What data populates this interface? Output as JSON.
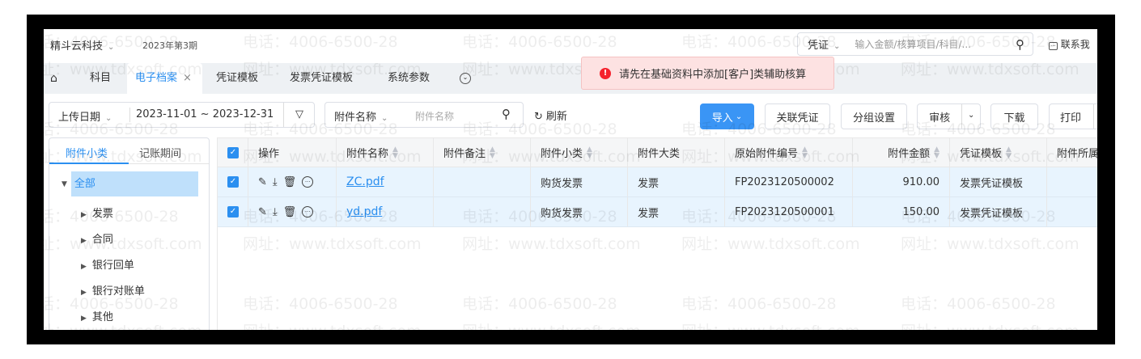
{
  "header": {
    "company": "精斗云科技",
    "period": "2023年第3期",
    "search_type": "凭证",
    "search_placeholder": "输入金额/核算项目/科目/...",
    "contact": "联系我"
  },
  "tabs": [
    {
      "label": "科目"
    },
    {
      "label": "电子档案",
      "active": true
    },
    {
      "label": "凭证模板"
    },
    {
      "label": "发票凭证模板"
    },
    {
      "label": "系统参数"
    }
  ],
  "toast": {
    "message": "请先在基础资料中添加[客户]类辅助核算",
    "color": "#f56c6c"
  },
  "toolbar": {
    "date_type": "上传日期",
    "date_range": "2023-11-01 ~ 2023-12-31",
    "name_field": "附件名称",
    "name_placeholder": "附件名称",
    "refresh": "刷新",
    "import": "导入",
    "link_voucher": "关联凭证",
    "group_settings": "分组设置",
    "review": "审核",
    "download": "下载",
    "print": "打印"
  },
  "sidebar": {
    "tabs": [
      "附件小类",
      "记账期间"
    ],
    "root": "全部",
    "items": [
      "发票",
      "合同",
      "银行回单",
      "银行对账单",
      "其他"
    ]
  },
  "table": {
    "columns": [
      "操作",
      "附件名称",
      "附件备注",
      "附件小类",
      "附件大类",
      "原始附件编号",
      "附件金额",
      "凭证模板",
      "附件所属"
    ],
    "rows": [
      {
        "name": "ZC.pdf",
        "remark": "",
        "subtype": "购货发票",
        "type": "发票",
        "number": "FP2023120500002",
        "amount": "910.00",
        "template": "发票凭证模板",
        "owner": ""
      },
      {
        "name": "yd.pdf",
        "remark": "",
        "subtype": "购货发票",
        "type": "发票",
        "number": "FP2023120500001",
        "amount": "150.00",
        "template": "发票凭证模板",
        "owner": ""
      }
    ]
  },
  "watermark": {
    "phone": "电话：4006-6500-28",
    "site": "网址：www.tdxsoft.com"
  },
  "colors": {
    "accent": "#2b8ff0",
    "selected_row": "#e8f4fe",
    "toast_bg": "#fde2e2"
  }
}
